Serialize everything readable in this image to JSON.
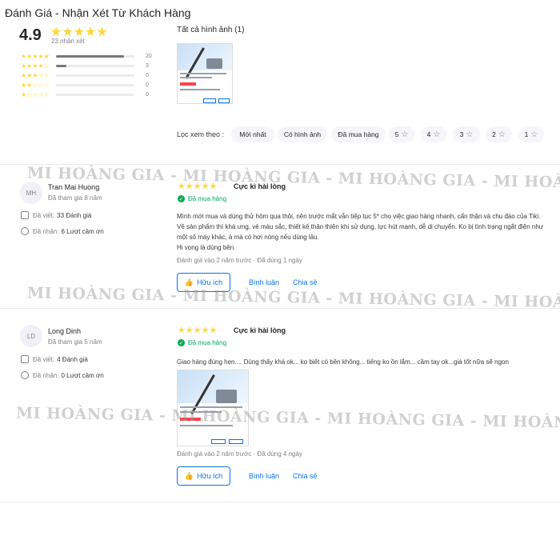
{
  "page_title": "Đánh Giá - Nhận Xét Từ Khách Hàng",
  "summary": {
    "average": "4.9",
    "stars": "★★★★★",
    "total_text": "23 nhận xét",
    "distribution": [
      {
        "stars": "★★★★★",
        "count": "20",
        "share": 0.87
      },
      {
        "stars": "★★★★☆",
        "count": "3",
        "share": 0.13
      },
      {
        "stars": "★★★☆☆",
        "count": "0",
        "share": 0
      },
      {
        "stars": "★★☆☆☆",
        "count": "0",
        "share": 0
      },
      {
        "stars": "★☆☆☆☆",
        "count": "0",
        "share": 0
      }
    ]
  },
  "photos": {
    "title": "Tất cả hình ảnh (1)"
  },
  "filter": {
    "label": "Lọc xem theo :",
    "chips": [
      "Mới nhất",
      "Có hình ảnh",
      "Đã mua hàng",
      "5",
      "4",
      "3",
      "2",
      "1"
    ],
    "star_glyph": "☆"
  },
  "watermark": "MI HOÀNG GIA - MI HOÀNG GIA - MI HOÀNG GIA - MI HOÀNG GIA",
  "reviews": [
    {
      "initials": "MH",
      "name": "Tran Mai Huong",
      "joined": "Đã tham gia 8 năm",
      "written_label": "Đã viết:",
      "written_value": "33 Đánh giá",
      "thanks_label": "Đã nhận:",
      "thanks_value": "6 Lượt cảm ơn",
      "stars": "★★★★★",
      "title": "Cực kì hài lòng",
      "bought": "Đã mua hàng",
      "content": "Mình mới mua và dùng thử hôm qua thôi, nên trước mắt vẫn tiếp tục 5* cho việc giao hàng nhanh, cẩn thận và chu đáo của Tiki.\nVề sản phẩm thì khá ưng, vẻ màu sắc, thiết kế thân thiện khi sử dụng, lực hút mạnh, dễ di chuyển. Ko bị tình trạng ngắt điện như một số máy khác, à mà có hơi nóng nếu dùng lâu.\nHi vọng là dùng bền.",
      "when": "Đánh giá vào 2 năm trước  ·  Đã dùng 1 ngày",
      "helpful": "Hữu ích",
      "comment": "Bình luận",
      "share": "Chia sẻ"
    },
    {
      "initials": "LD",
      "name": "Long Dinh",
      "joined": "Đã tham gia 5 năm",
      "written_label": "Đã viết:",
      "written_value": "4 Đánh giá",
      "thanks_label": "Đã nhận:",
      "thanks_value": "0 Lượt cảm ơn",
      "stars": "★★★★★",
      "title": "Cực kì hài lòng",
      "bought": "Đã mua hàng",
      "content": "Giao hàng đúng hẹn.... Dùng thấy khá ok... ko biết có bền không... tiếng ko ồn lắm... cầm tay ok...giá tốt nữa sẽ ngon",
      "when": "Đánh giá vào 2 năm trước  ·  Đã dùng 4 ngày",
      "helpful": "Hữu ích",
      "comment": "Bình luận",
      "share": "Chia sẻ"
    }
  ],
  "colors": {
    "star": "#fdd836",
    "link": "#0b74e5",
    "success": "#00ab56",
    "price": "#ff424e"
  },
  "icons": [
    "star-icon",
    "check-circle-icon",
    "comment-icon",
    "like-icon",
    "thumb-up-icon"
  ]
}
